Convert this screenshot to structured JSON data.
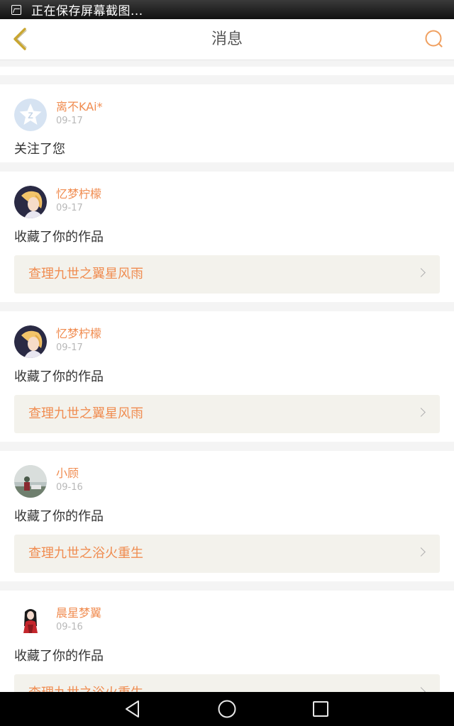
{
  "status_bar": {
    "text": "正在保存屏幕截图...",
    "icon": "screenshot-icon"
  },
  "header": {
    "title": "消息",
    "back_icon": "chevron-left-icon",
    "search_icon": "search-icon"
  },
  "colors": {
    "accent": "#f08c50",
    "back_icon": "#c9a630",
    "text_primary": "#333333",
    "text_muted": "#b8b8b8",
    "card_bg": "#ffffff",
    "work_bg": "#f3f2ec",
    "page_bg": "#f4f4f4"
  },
  "notifications": [
    {
      "user": "离不KAi*",
      "date": "09-17",
      "action": "关注了您",
      "avatar": "default-avatar-icon"
    },
    {
      "user": "忆梦柠檬",
      "date": "09-17",
      "action": "收藏了你的作品",
      "work": "查理九世之翼星风雨",
      "avatar": "anime-girl-avatar"
    },
    {
      "user": "忆梦柠檬",
      "date": "09-17",
      "action": "收藏了你的作品",
      "work": "查理九世之翼星风雨",
      "avatar": "anime-girl-avatar"
    },
    {
      "user": "小顾",
      "date": "09-16",
      "action": "收藏了你的作品",
      "work": "查理九世之浴火重生",
      "avatar": "photo-avatar"
    },
    {
      "user": "晨星梦翼",
      "date": "09-16",
      "action": "收藏了你的作品",
      "work": "查理九世之浴火重生",
      "avatar": "red-dress-girl-avatar"
    }
  ],
  "nav_bar": {
    "back": "triangle-back-icon",
    "home": "circle-home-icon",
    "recent": "square-recent-icon"
  }
}
